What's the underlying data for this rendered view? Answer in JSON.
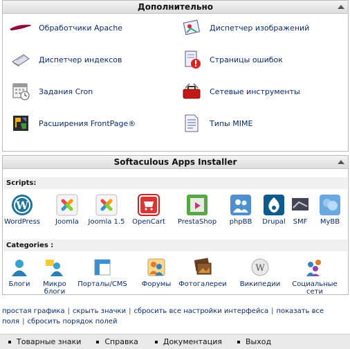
{
  "advanced": {
    "title": "Дополнительно",
    "items": [
      {
        "label": "Обработчики Apache",
        "icon": "apache-feather-icon"
      },
      {
        "label": "Диспетчер изображений",
        "icon": "image-manager-icon"
      },
      {
        "label": "Диспетчер индексов",
        "icon": "index-manager-icon"
      },
      {
        "label": "Страницы ошибок",
        "icon": "error-pages-icon"
      },
      {
        "label": "Задания Cron",
        "icon": "cron-calendar-icon"
      },
      {
        "label": "Сетевые инструменты",
        "icon": "network-tools-icon"
      },
      {
        "label": "Расширения FrontPage®",
        "icon": "frontpage-icon"
      },
      {
        "label": "Типы MIME",
        "icon": "mime-types-icon"
      }
    ]
  },
  "softaculous": {
    "title": "Softaculous Apps Installer",
    "scripts_label": "Scripts:",
    "scripts": [
      {
        "label": "WordPress",
        "icon": "wordpress-icon"
      },
      {
        "label": "Joomla",
        "icon": "joomla-icon"
      },
      {
        "label": "Joomla 1.5",
        "icon": "joomla15-icon"
      },
      {
        "label": "OpenCart",
        "icon": "opencart-icon"
      },
      {
        "label": "PrestaShop",
        "icon": "prestashop-icon"
      },
      {
        "label": "phpBB",
        "icon": "phpbb-icon"
      },
      {
        "label": "Drupal",
        "icon": "drupal-icon"
      },
      {
        "label": "SMF",
        "icon": "smf-icon"
      },
      {
        "label": "MyBB",
        "icon": "mybb-icon"
      }
    ],
    "categories_label": "Categories :",
    "categories": [
      {
        "label": "Блоги",
        "icon": "blogs-icon"
      },
      {
        "label": "Микро блоги",
        "icon": "micro-blogs-icon"
      },
      {
        "label": "Порталы/CMS",
        "icon": "portals-cms-icon"
      },
      {
        "label": "Форумы",
        "icon": "forums-icon"
      },
      {
        "label": "Фотогалереи",
        "icon": "photo-gallery-icon"
      },
      {
        "label": "Википедии",
        "icon": "wiki-icon"
      },
      {
        "label": "Социальные сети",
        "icon": "social-networks-icon"
      }
    ]
  },
  "settings_links": [
    "простая графика",
    "скрыть значки",
    "сбросить все настройки интерфейса",
    "показать все поля",
    "сбросить порядок полей"
  ],
  "footer": [
    "Товарные знаки",
    "Справка",
    "Документация",
    "Выход"
  ]
}
